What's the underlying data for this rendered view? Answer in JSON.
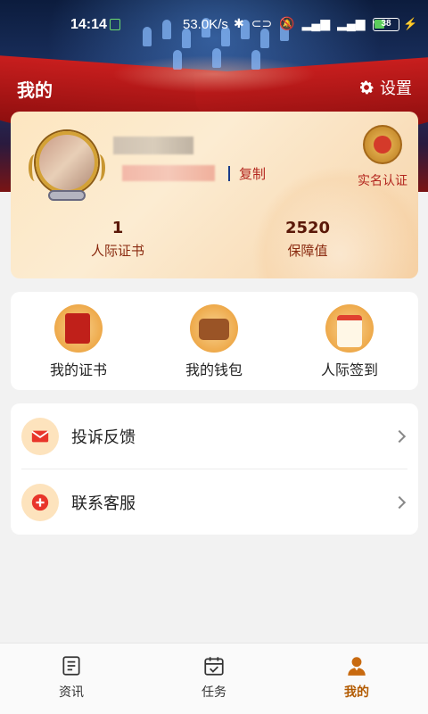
{
  "status_bar": {
    "time": "14:14",
    "network_speed": "53.0K/s",
    "battery": "38"
  },
  "header": {
    "title": "我的",
    "settings_label": "设置"
  },
  "profile": {
    "copy_label": "复制",
    "verify_label": "实名认证",
    "stats": [
      {
        "value": "1",
        "label": "人际证书"
      },
      {
        "value": "2520",
        "label": "保障值"
      }
    ]
  },
  "shortcuts": [
    {
      "label": "我的证书",
      "icon": "certificate-icon"
    },
    {
      "label": "我的钱包",
      "icon": "wallet-icon"
    },
    {
      "label": "人际签到",
      "icon": "calendar-checkin-icon"
    }
  ],
  "menu": [
    {
      "label": "投诉反馈",
      "icon": "mail-icon"
    },
    {
      "label": "联系客服",
      "icon": "plus-circle-icon"
    }
  ],
  "bottom_nav": [
    {
      "label": "资讯",
      "icon": "news-icon",
      "active": false
    },
    {
      "label": "任务",
      "icon": "task-calendar-icon",
      "active": false
    },
    {
      "label": "我的",
      "icon": "profile-icon",
      "active": true
    }
  ],
  "colors": {
    "accent": "#b3261e",
    "active_tab": "#b25a00",
    "card_gold": "#fde6c0"
  }
}
